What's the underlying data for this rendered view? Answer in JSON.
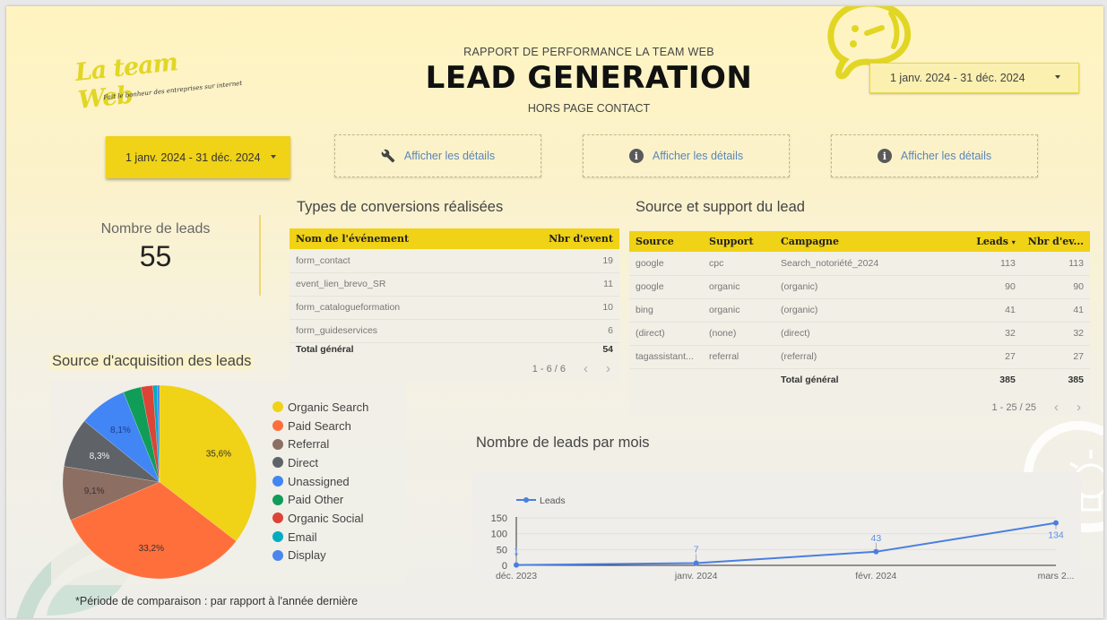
{
  "header": {
    "logo_text": "La team Web",
    "logo_tagline": "Fait le bonheur des entreprises sur internet",
    "subtitle_top": "RAPPORT DE PERFORMANCE LA TEAM WEB",
    "title": "LEAD GENERATION",
    "subtitle_bottom": "HORS PAGE CONTACT"
  },
  "date_range_top": {
    "value": "1 janv. 2024 - 31 déc. 2024",
    "icon": "caret-down-icon"
  },
  "date_range_main": {
    "value": "1 janv. 2024 - 31 déc. 2024",
    "icon": "caret-down-icon"
  },
  "detail_buttons": [
    {
      "label": "Afficher les détails",
      "icon": "wrench-icon"
    },
    {
      "label": "Afficher les détails",
      "icon": "info-icon"
    },
    {
      "label": "Afficher les détails",
      "icon": "info-icon"
    }
  ],
  "kpi": {
    "label": "Nombre de leads",
    "value": "55"
  },
  "conversions": {
    "title": "Types de conversions réalisées",
    "columns": [
      "Nom de l'événement",
      "Nbr d'event"
    ],
    "rows": [
      [
        "form_contact",
        "19"
      ],
      [
        "event_lien_brevo_SR",
        "11"
      ],
      [
        "form_catalogueformation",
        "10"
      ],
      [
        "form_guideservices",
        "6"
      ]
    ],
    "total": [
      "Total général",
      "54"
    ],
    "pager": "1 - 6 / 6"
  },
  "sources": {
    "title": "Source et support du lead",
    "columns": [
      "Source",
      "Support",
      "Campagne",
      "Leads",
      "Nbr d'ev..."
    ],
    "sort_indicator": "▾",
    "rows": [
      [
        "google",
        "cpc",
        "Search_notoriété_2024",
        "113",
        "113"
      ],
      [
        "google",
        "organic",
        "(organic)",
        "90",
        "90"
      ],
      [
        "bing",
        "organic",
        "(organic)",
        "41",
        "41"
      ],
      [
        "(direct)",
        "(none)",
        "(direct)",
        "32",
        "32"
      ],
      [
        "tagassistant...",
        "referral",
        "(referral)",
        "27",
        "27"
      ]
    ],
    "total": [
      "",
      "",
      "Total général",
      "385",
      "385"
    ],
    "pager": "1 - 25 / 25"
  },
  "footnote": "*Période de comparaison : par rapport à l'année dernière",
  "chart_data": [
    {
      "type": "pie",
      "title": "Source d'acquisition des leads",
      "legend_position": "right",
      "categories": [
        "Organic Search",
        "Paid Search",
        "Referral",
        "Direct",
        "Unassigned",
        "Paid Other",
        "Organic Social",
        "Email",
        "Display"
      ],
      "values": [
        35.6,
        33.2,
        9.1,
        8.3,
        8.1,
        3.0,
        2.0,
        0.7,
        0.4
      ],
      "labels": [
        "35,6%",
        "33,2%",
        "9,1%",
        "8,3%",
        "8,1%",
        "",
        "",
        "",
        ""
      ],
      "colors": [
        "#f0d216",
        "#ff6f3c",
        "#8d6e63",
        "#5f6368",
        "#4285f4",
        "#0f9d58",
        "#db4437",
        "#00acc1",
        "#4a86f0"
      ]
    },
    {
      "type": "line",
      "title": "Nombre de leads par mois",
      "legend": [
        "Leads"
      ],
      "legend_position": "top-left",
      "x": [
        "déc. 2023",
        "janv. 2024",
        "févr. 2024",
        "mars 2..."
      ],
      "series": [
        {
          "name": "Leads",
          "values": [
            1,
            7,
            43,
            134
          ],
          "color": "#4a7fe0"
        }
      ],
      "yticks": [
        "0",
        "50",
        "100",
        "150"
      ],
      "ylim": [
        0,
        150
      ],
      "grid": true
    }
  ]
}
